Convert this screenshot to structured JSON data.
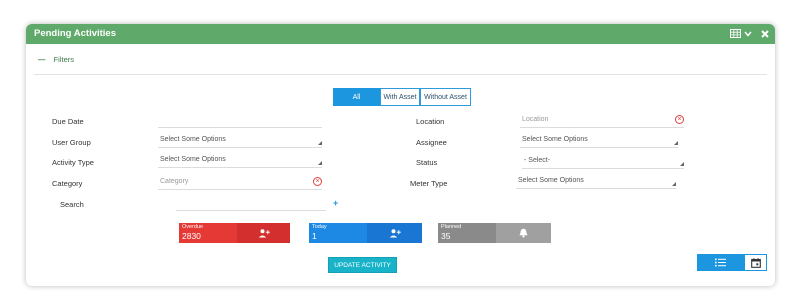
{
  "header": {
    "title": "Pending Activities",
    "bg_color": "#5fa96b",
    "icons": [
      "grid-icon",
      "chevron-down-icon",
      "close-icon"
    ]
  },
  "filters": {
    "toggle": "—",
    "label": "Filters"
  },
  "segments": [
    {
      "label": "All",
      "active": true
    },
    {
      "label": "With Asset",
      "active": false
    },
    {
      "label": "Without Asset",
      "active": false
    }
  ],
  "form": {
    "due_date": {
      "label": "Due Date"
    },
    "location": {
      "label": "Location",
      "placeholder": "Location"
    },
    "user_group": {
      "label": "User Group",
      "value": "Select Some Options"
    },
    "assignee": {
      "label": "Assignee",
      "value": "Select Some Options"
    },
    "activity_type": {
      "label": "Activity Type",
      "value": "Select Some Options"
    },
    "status": {
      "label": "Status",
      "value": "- Select-"
    },
    "category": {
      "label": "Category",
      "placeholder": "Category"
    },
    "meter_type": {
      "label": "Meter Type",
      "value": "Select Some Options"
    },
    "search": {
      "label": "Search"
    }
  },
  "cards": [
    {
      "title": "Overdue",
      "value": "2830",
      "color_left": "#e53935",
      "color_right": "#d32f2f",
      "icon": "user-plus-icon"
    },
    {
      "title": "Today",
      "value": "1",
      "color_left": "#1e88e5",
      "color_right": "#1976d2",
      "icon": "user-plus-icon"
    },
    {
      "title": "Planned",
      "value": "35",
      "color_left": "#8a8a8a",
      "color_right": "#a0a0a0",
      "icon": "bell-icon"
    }
  ],
  "update_button": {
    "label": "UPDATE ACTIVITY"
  },
  "view_toggle": {
    "list_icon": "list-icon",
    "calendar_icon": "calendar-icon",
    "color": "#1d96e0"
  }
}
